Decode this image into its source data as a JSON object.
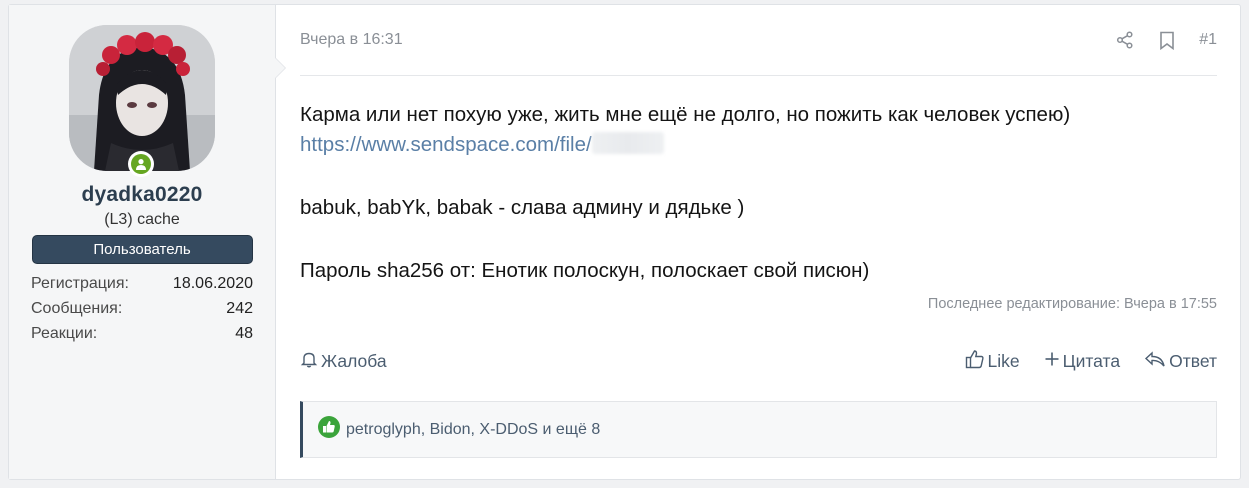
{
  "user": {
    "username": "dyadka0220",
    "title": "(L3) cache",
    "banner": "Пользователь",
    "stats": [
      {
        "label": "Регистрация:",
        "value": "18.06.2020"
      },
      {
        "label": "Сообщения:",
        "value": "242"
      },
      {
        "label": "Реакции:",
        "value": "48"
      }
    ],
    "online": true
  },
  "post": {
    "date": "Вчера в 16:31",
    "number": "#1",
    "lines": {
      "line1": "Карма или нет похую уже, жить мне ещё не долго, но пожить как человек успею)",
      "link": "https://www.sendspace.com/file/",
      "line3": "babuk, babYk, babak - слава админу и дядьке )",
      "line4": "Пароль sha256 от: Енотик полоскун, полоскает свой писюн)"
    },
    "edited": "Последнее редактирование: Вчера в 17:55"
  },
  "actions": {
    "report": "Жалоба",
    "like": "Like",
    "quote": "Цитата",
    "reply": "Ответ"
  },
  "reactions": {
    "text": "petroglyph, Bidon, X-DDoS и ещё 8"
  },
  "colors": {
    "accent": "#354a5f",
    "online": "#65a621",
    "link": "#5a7fa6",
    "reaction": "#3ba43b"
  },
  "icons": [
    "share-icon",
    "bookmark-icon",
    "bell-icon",
    "thumbs-up-icon",
    "plus-icon",
    "reply-icon",
    "online-user-icon",
    "like-reaction-icon"
  ]
}
